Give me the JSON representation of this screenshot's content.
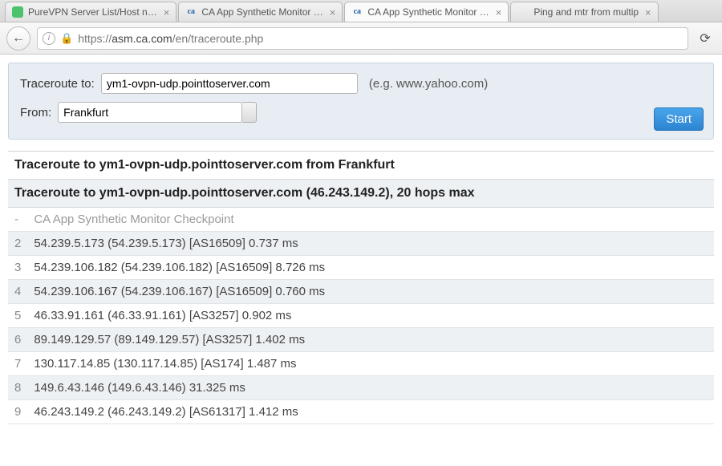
{
  "tabs": [
    {
      "label": "PureVPN Server List/Host n…",
      "favicon": "green",
      "active": false
    },
    {
      "label": "CA App Synthetic Monitor …",
      "favicon": "ca",
      "active": false
    },
    {
      "label": "CA App Synthetic Monitor …",
      "favicon": "ca",
      "active": true
    },
    {
      "label": "Ping and mtr from multip",
      "favicon": "",
      "active": false
    }
  ],
  "url": {
    "scheme": "https://",
    "host": "asm.ca.com",
    "path": "/en/traceroute.php"
  },
  "form": {
    "traceroute_label": "Traceroute to:",
    "host_value": "ym1-ovpn-udp.pointtoserver.com",
    "hint": "(e.g. www.yahoo.com)",
    "from_label": "From:",
    "from_value": "Frankfurt",
    "start_label": "Start"
  },
  "results": {
    "heading": "Traceroute to ym1-ovpn-udp.pointtoserver.com from Frankfurt",
    "subheading": "Traceroute to ym1-ovpn-udp.pointtoserver.com (46.243.149.2), 20 hops max",
    "rows": [
      {
        "hop": "-",
        "text": "CA App Synthetic Monitor Checkpoint"
      },
      {
        "hop": "2",
        "text": "54.239.5.173 (54.239.5.173) [AS16509] 0.737 ms"
      },
      {
        "hop": "3",
        "text": "54.239.106.182 (54.239.106.182) [AS16509] 8.726 ms"
      },
      {
        "hop": "4",
        "text": "54.239.106.167 (54.239.106.167) [AS16509] 0.760 ms"
      },
      {
        "hop": "5",
        "text": "46.33.91.161 (46.33.91.161) [AS3257] 0.902 ms"
      },
      {
        "hop": "6",
        "text": "89.149.129.57 (89.149.129.57) [AS3257] 1.402 ms"
      },
      {
        "hop": "7",
        "text": "130.117.14.85 (130.117.14.85) [AS174] 1.487 ms"
      },
      {
        "hop": "8",
        "text": "149.6.43.146 (149.6.43.146) 31.325 ms"
      },
      {
        "hop": "9",
        "text": "46.243.149.2 (46.243.149.2) [AS61317] 1.412 ms"
      }
    ]
  }
}
